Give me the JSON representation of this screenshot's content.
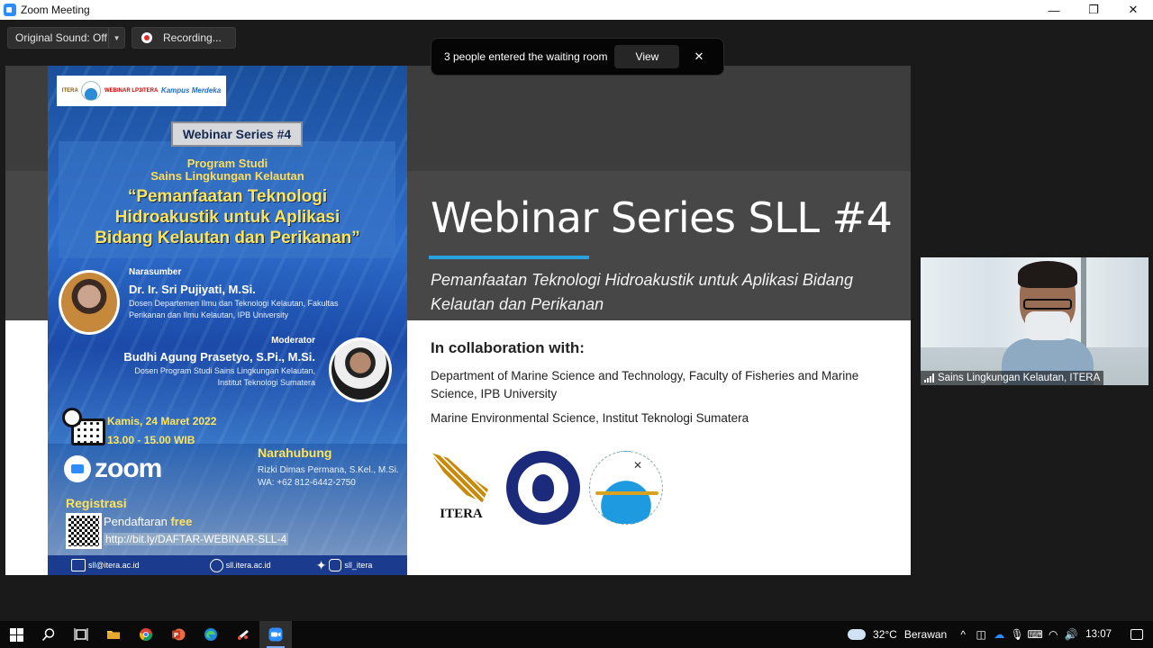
{
  "window": {
    "title": "Zoom Meeting",
    "minimize": "—",
    "restore": "❐",
    "close": "✕"
  },
  "toolbar": {
    "original_sound_label": "Original Sound: Off",
    "recording_label": "Recording..."
  },
  "notification": {
    "message": "3 people entered the waiting room",
    "view_label": "View",
    "close_glyph": "✕"
  },
  "poster": {
    "series_tag": "Webinar Series #4",
    "logo_itera": "ITERA",
    "logo_webinar": "WEBINAR LP3ITERA",
    "logo_kampus": "Kampus Merdeka",
    "program_line1": "Program Studi",
    "program_line2": "Sains Lingkungan Kelautan",
    "title_line1": "“Pemanfaatan Teknologi",
    "title_line2": "Hidroakustik untuk Aplikasi",
    "title_line3": "Bidang Kelautan dan Perikanan”",
    "speaker_label": "Narasumber",
    "speaker_name": "Dr. Ir. Sri Pujiyati, M.Si.",
    "speaker_desc1": "Dosen Departemen Ilmu dan Teknologi Kelautan, Fakultas",
    "speaker_desc2": "Perikanan dan Ilmu Kelautan, IPB University",
    "moderator_label": "Moderator",
    "moderator_name": "Budhi Agung Prasetyo, S.Pi., M.Si.",
    "moderator_desc1": "Dosen Program Studi Sains Lingkungan Kelautan,",
    "moderator_desc2": "Institut Teknologi Sumatera",
    "date": "Kamis, 24 Maret 2022",
    "time": "13.00 - 15.00 WIB",
    "zoom_word": "zoom",
    "contact_label": "Narahubung",
    "contact_name": "Rizki Dimas Permana, S.Kel., M.Si.",
    "contact_wa": "WA: +62 812-6442-2750",
    "reg_label": "Registrasi",
    "reg_text": "Pendaftaran",
    "reg_free": "free",
    "reg_link": "http://bit.ly/DAFTAR-WEBINAR-SLL-4",
    "footer_email": "sll@itera.ac.id",
    "footer_web": "sll.itera.ac.id",
    "footer_social": "sll_itera"
  },
  "slide": {
    "title": "Webinar Series SLL #4",
    "subtitle": "Pemanfaatan Teknologi Hidroakustik untuk Aplikasi Bidang Kelautan dan Perikanan",
    "collab_heading": "In collaboration with:",
    "collab_1": "Department of Marine Science and Technology, Faculty of Fisheries and Marine Science, IPB University",
    "collab_2": "Marine Environmental Science, Institut Teknologi Sumatera",
    "itera_word": "ITERA"
  },
  "video": {
    "participant_name": "Sains Lingkungan Kelautan, ITERA"
  },
  "taskbar": {
    "temperature": "32°C",
    "weather": "Berawan",
    "time": "13:07",
    "tray_chevron": "^"
  }
}
